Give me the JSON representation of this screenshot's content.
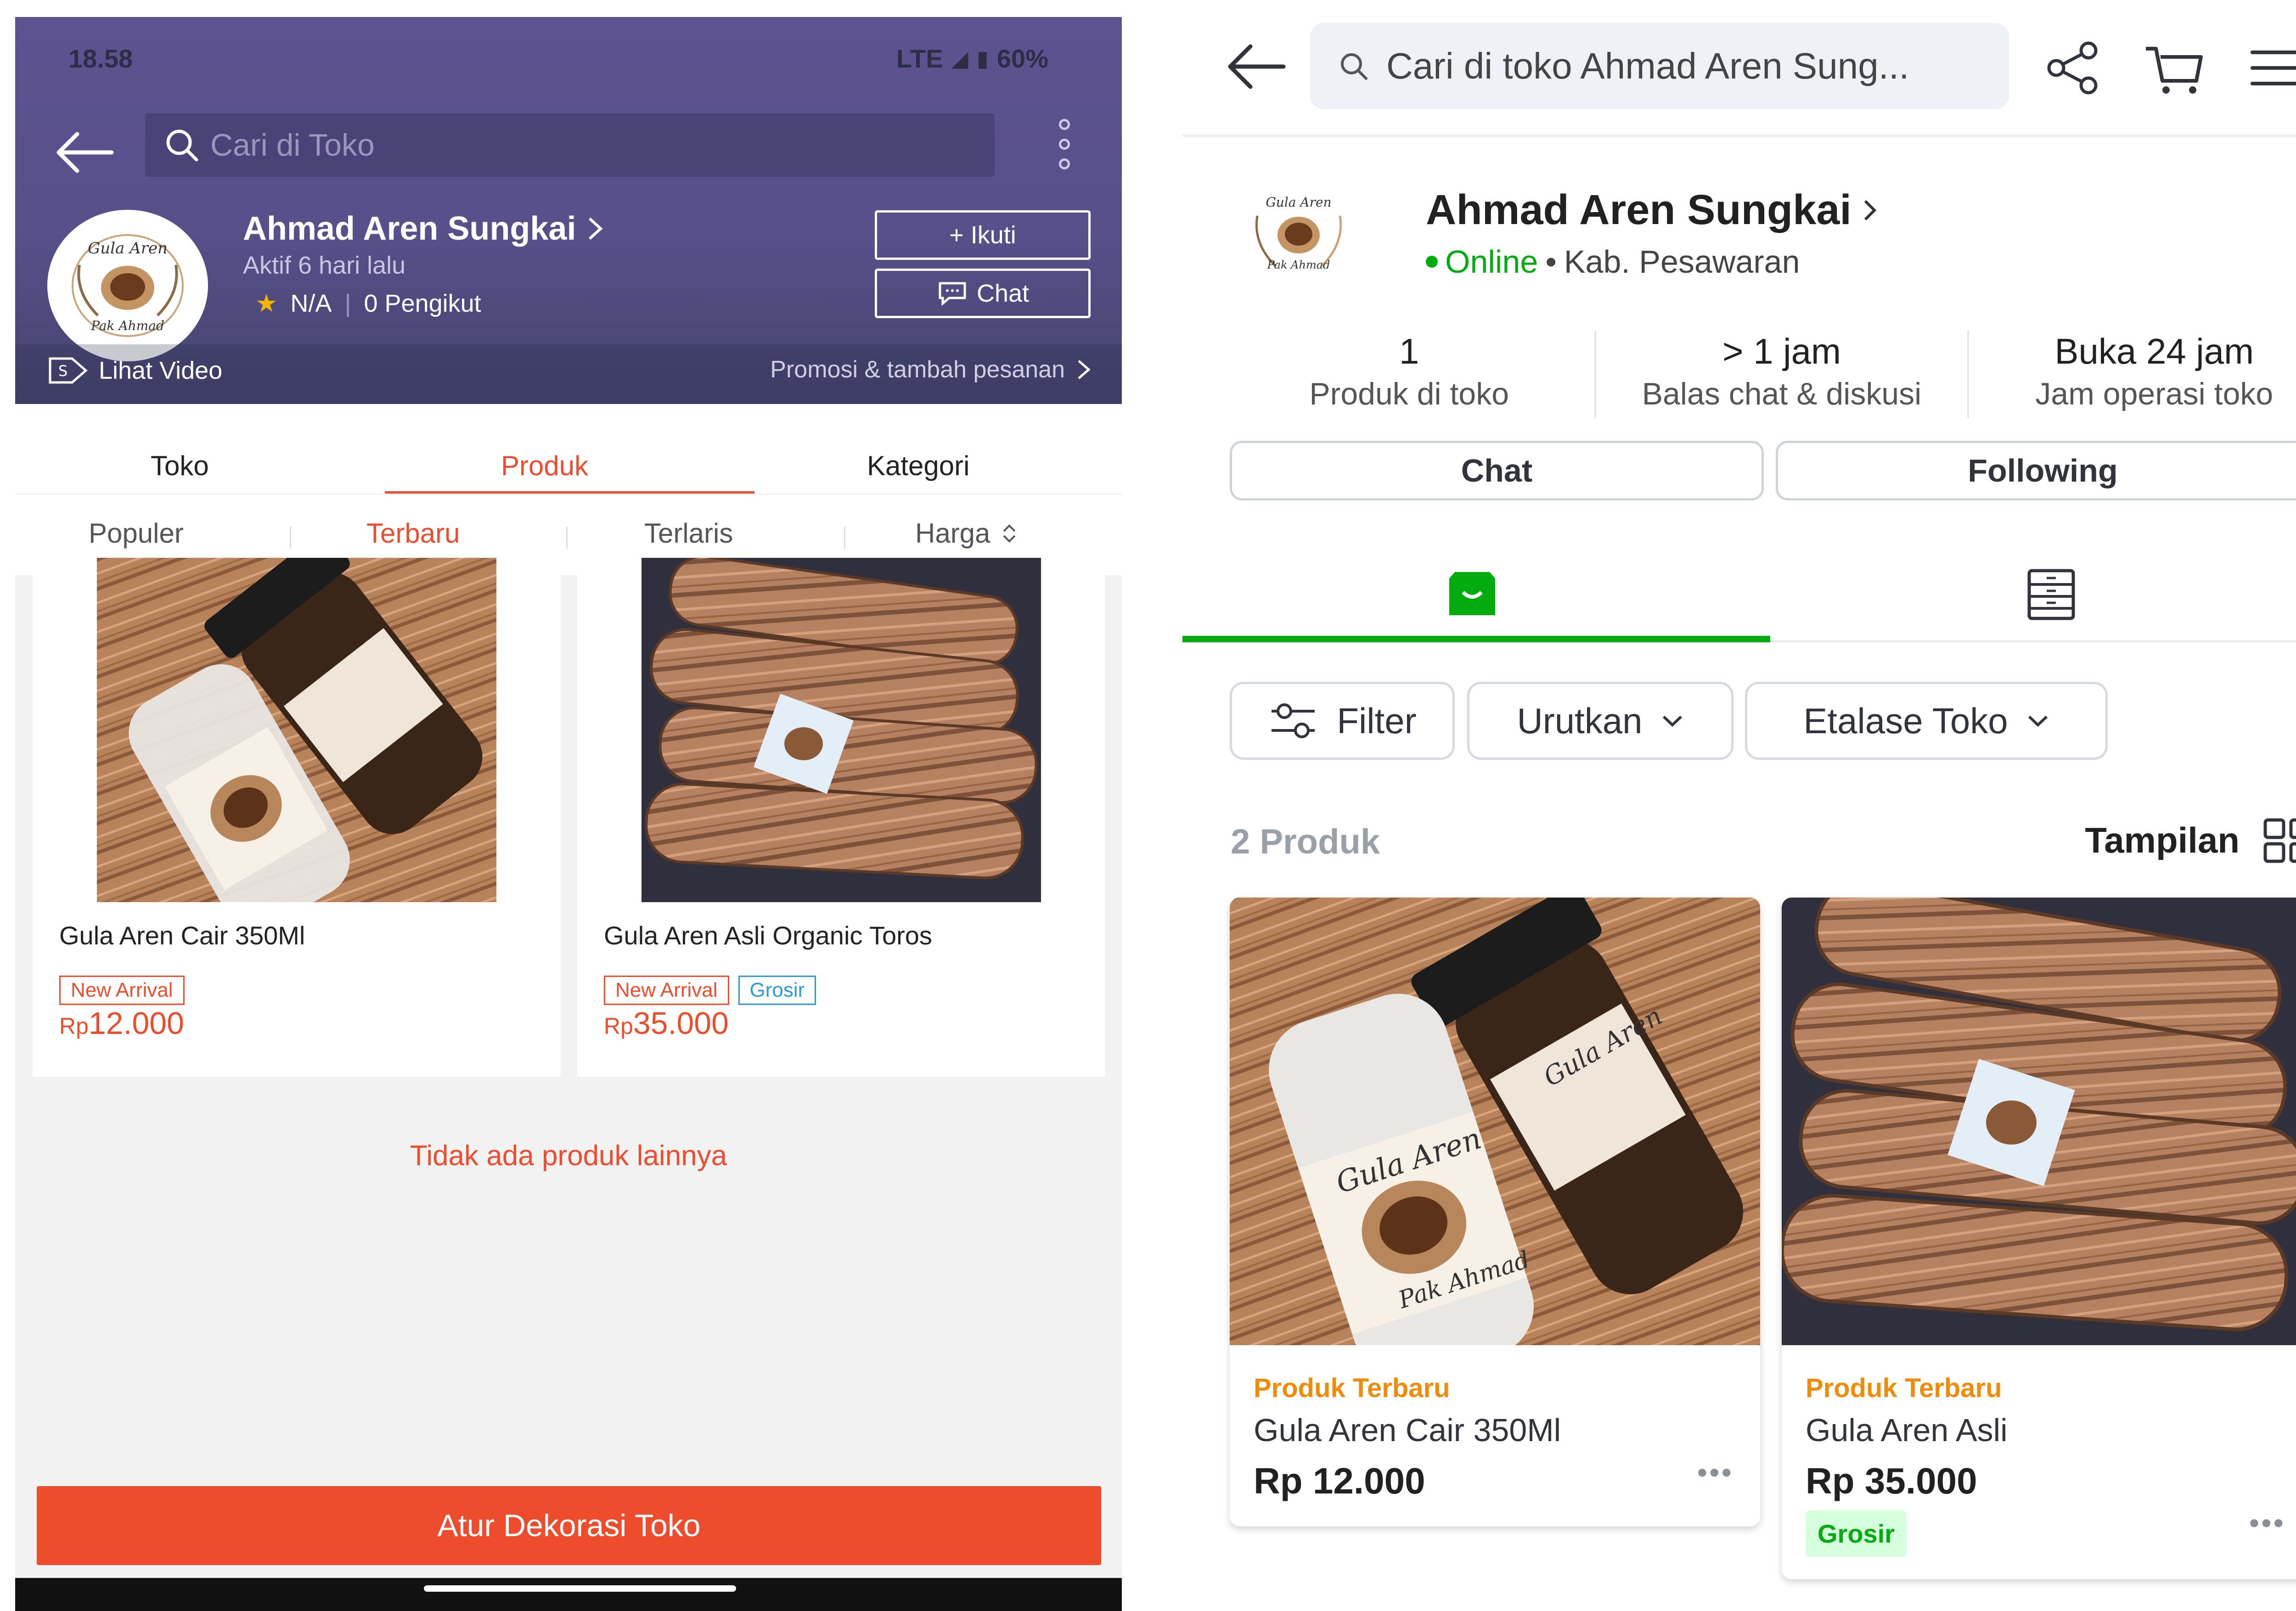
{
  "left": {
    "status": {
      "time": "18.58",
      "network": "LTE",
      "battery": "60%"
    },
    "search_placeholder": "Cari di Toko",
    "shop": {
      "name": "Ahmad Aren Sungkai",
      "active": "Aktif 6 hari lalu",
      "rating": "N/A",
      "followers": "0 Pengikut",
      "follow_label": "+ Ikuti",
      "chat_label": "Chat",
      "logo_text": "Gula Aren Pak Ahmad"
    },
    "video_label": "Lihat Video",
    "promo_label": "Promosi & tambah pesanan",
    "tabs": [
      "Toko",
      "Produk",
      "Kategori"
    ],
    "sorts": [
      "Populer",
      "Terbaru",
      "Terlaris",
      "Harga"
    ],
    "products": [
      {
        "name": "Gula Aren Cair 350Ml",
        "badges": [
          "New Arrival"
        ],
        "currency": "Rp",
        "price": "12.000"
      },
      {
        "name": "Gula Aren Asli Organic Toros",
        "badges": [
          "New Arrival",
          "Grosir"
        ],
        "currency": "Rp",
        "price": "35.000"
      }
    ],
    "no_more": "Tidak ada produk lainnya",
    "cta": "Atur Dekorasi Toko",
    "accent": "#ee4d2d"
  },
  "right": {
    "search_placeholder": "Cari di toko Ahmad Aren Sung...",
    "shop": {
      "name": "Ahmad Aren Sungkai",
      "status": "Online",
      "location": "Kab. Pesawaran"
    },
    "stats": [
      {
        "value": "1",
        "label": "Produk di toko"
      },
      {
        "value": "> 1 jam",
        "label": "Balas chat & diskusi"
      },
      {
        "value": "Buka 24 jam",
        "label": "Jam operasi toko"
      }
    ],
    "chat_label": "Chat",
    "following_label": "Following",
    "chips": {
      "filter": "Filter",
      "sort": "Urutkan",
      "etalase": "Etalase Toko"
    },
    "count": "2 Produk",
    "view_label": "Tampilan",
    "products": [
      {
        "label": "Produk Terbaru",
        "name": "Gula Aren Cair 350Ml",
        "price": "Rp 12.000"
      },
      {
        "label": "Produk Terbaru",
        "name": "Gula Aren Asli",
        "price": "Rp 35.000",
        "badge": "Grosir"
      }
    ],
    "accent": "#03ac0e"
  }
}
